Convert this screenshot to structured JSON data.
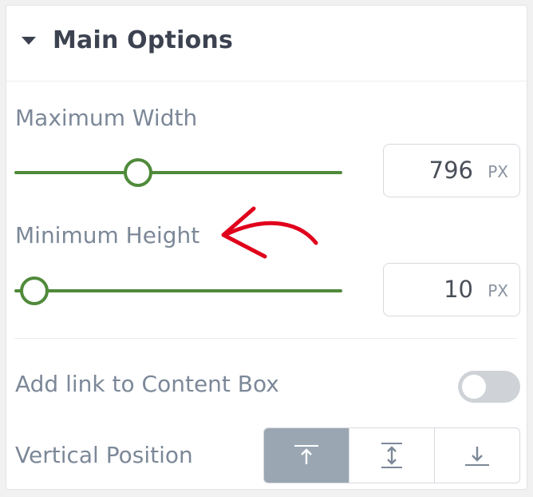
{
  "section": {
    "title": "Main Options",
    "expanded": true
  },
  "max_width": {
    "label": "Maximum Width",
    "value": "796",
    "unit": "PX"
  },
  "min_height": {
    "label": "Minimum Height",
    "value": "10",
    "unit": "PX"
  },
  "link_toggle": {
    "label": "Add link to Content Box",
    "enabled": false
  },
  "vertical_position": {
    "label": "Vertical Position",
    "options": [
      {
        "icon": "align-top-icon",
        "selected": true
      },
      {
        "icon": "align-middle-icon",
        "selected": false
      },
      {
        "icon": "align-bottom-icon",
        "selected": false
      }
    ]
  },
  "colors": {
    "slider": "#4f8a3a",
    "annotation_arrow": "#e0001b",
    "segment_active": "#9aa6b2"
  }
}
